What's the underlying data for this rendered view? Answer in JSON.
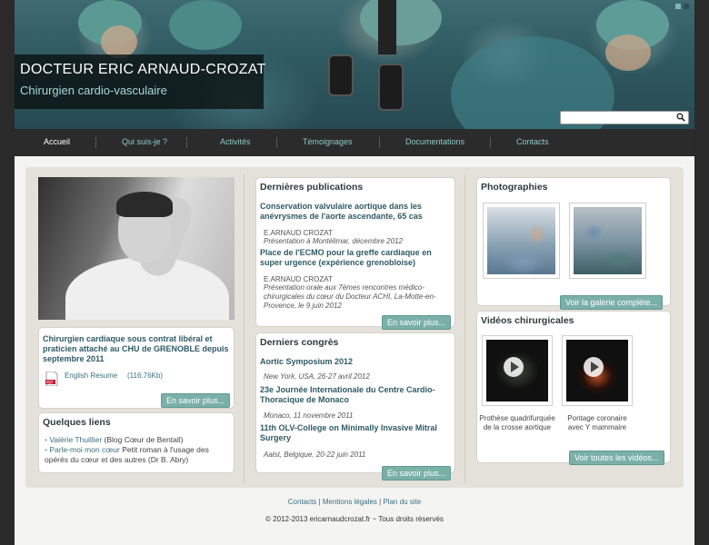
{
  "header": {
    "title": "DOCTEUR ERIC ARNAUD-CROZAT",
    "subtitle": "Chirurgien cardio-vasculaire",
    "search_placeholder": ""
  },
  "nav": {
    "items": [
      "Accueil",
      "Qui suis-je ?",
      "Activités",
      "Témoignages",
      "Documentations",
      "Contacts"
    ],
    "active": "Accueil"
  },
  "profile": {
    "description": "Chirurgien cardiaque sous contrat libéral et praticien attaché au CHU de GRENOBLE depuis septembre 2011",
    "resume_link": "English Resume",
    "resume_size": "(116.76Kb)",
    "more_button": "En savoir plus..."
  },
  "links": {
    "heading": "Quelques liens",
    "items": [
      {
        "link": "Valérie Thuillier",
        "text": "(Blog Cœur de Bentall)"
      },
      {
        "link": "Parle-moi mon cœur",
        "text": "Petit roman à l'usage des opérés du cœur et des autres (Dr B. Abry)"
      }
    ]
  },
  "publications": {
    "heading": "Dernières publications",
    "items": [
      {
        "title": "Conservation valvulaire aortique dans les anévrysmes de l'aorte ascendante, 65 cas",
        "author": "E.ARNAUD CROZAT",
        "detail": "Présentation à Montélimar, décembre 2012"
      },
      {
        "title": "Place de l'ECMO pour la greffe cardiaque en super urgence (expérience grenobloise)",
        "author": "E.ARNAUD CROZAT",
        "detail": "Présentation orale aux 7èmes rencontres médico-chirurgicales du cœur du Docteur ACHI, La-Motte-en-Provence, le 9 juin 2012"
      }
    ],
    "more_button": "En savoir plus..."
  },
  "congresses": {
    "heading": "Derniers congrès",
    "items": [
      {
        "title": "Aortic Symposium 2012",
        "detail": "New York, USA, 26-27 avril 2012"
      },
      {
        "title": "23e Journée Internationale du Centre Cardio-Thoracique de Monaco",
        "detail": "Monaco, 11 novembre 2011"
      },
      {
        "title": "11th OLV-College on Minimally Invasive Mitral Surgery",
        "detail": "Aalst, Belgique, 20-22 juin 2011"
      }
    ],
    "more_button": "En savoir plus..."
  },
  "photos": {
    "heading": "Photographies",
    "gallery_button": "Voir la galerie complète..."
  },
  "videos": {
    "heading": "Vidéos chirurgicales",
    "items": [
      {
        "caption": "Prothèse quadrifurquée de la crosse aortique"
      },
      {
        "caption": "Pontage coronaire avec Y mammaire"
      }
    ],
    "all_button": "Voir toutes les vidéos..."
  },
  "footer": {
    "links": [
      "Contacts",
      "Mentions légales",
      "Plan du site"
    ],
    "copyright": "© 2012-2013 ericarnaudcrozat.fr ~ Tous droits réservés"
  },
  "colors": {
    "accent": "#7ab0a8",
    "nav_link": "#8fc9c9",
    "heading_link": "#2f5a66"
  }
}
